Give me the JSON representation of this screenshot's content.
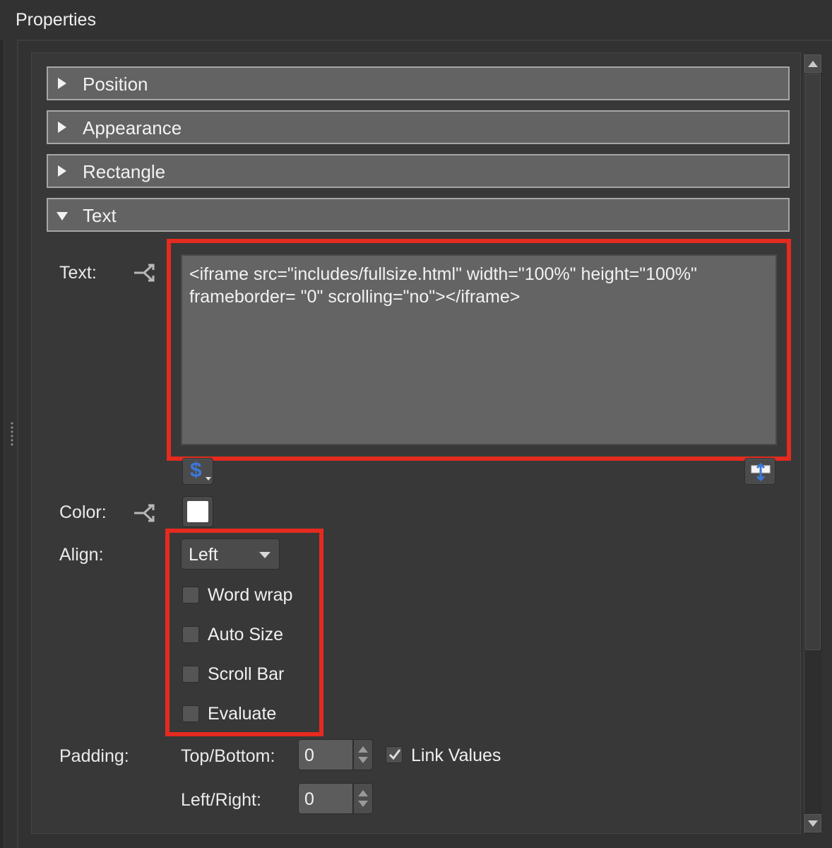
{
  "panel": {
    "title": "Properties"
  },
  "sections": [
    {
      "label": "Position",
      "expanded": false
    },
    {
      "label": "Appearance",
      "expanded": false
    },
    {
      "label": "Rectangle",
      "expanded": false
    },
    {
      "label": "Text",
      "expanded": true
    }
  ],
  "text_section": {
    "text_label": "Text:",
    "text_value": "<iframe src=\"includes/fullsize.html\" width=\"100%\" height=\"100%\" frameborder= \"0\" scrolling=\"no\"></iframe>",
    "dollar_button_glyph": "$",
    "color_label": "Color:",
    "color_value": "#ffffff",
    "align_label": "Align:",
    "align_value": "Left",
    "checkboxes": [
      {
        "label": "Word wrap",
        "checked": false
      },
      {
        "label": "Auto Size",
        "checked": false
      },
      {
        "label": "Scroll Bar",
        "checked": false
      },
      {
        "label": "Evaluate",
        "checked": false
      }
    ],
    "padding_label": "Padding:",
    "top_bottom_label": "Top/Bottom:",
    "top_bottom_value": "0",
    "left_right_label": "Left/Right:",
    "left_right_value": "0",
    "link_values_label": "Link Values",
    "link_values_checked": true
  },
  "colors": {
    "highlight": "#e52a1f",
    "header_bg": "#636363",
    "panel_bg": "#383838"
  },
  "icons": [
    "link-icon",
    "dollar-icon",
    "edit-text-icon",
    "chevron-down-icon",
    "checkmark-icon",
    "disclosure-triangle-icon"
  ]
}
